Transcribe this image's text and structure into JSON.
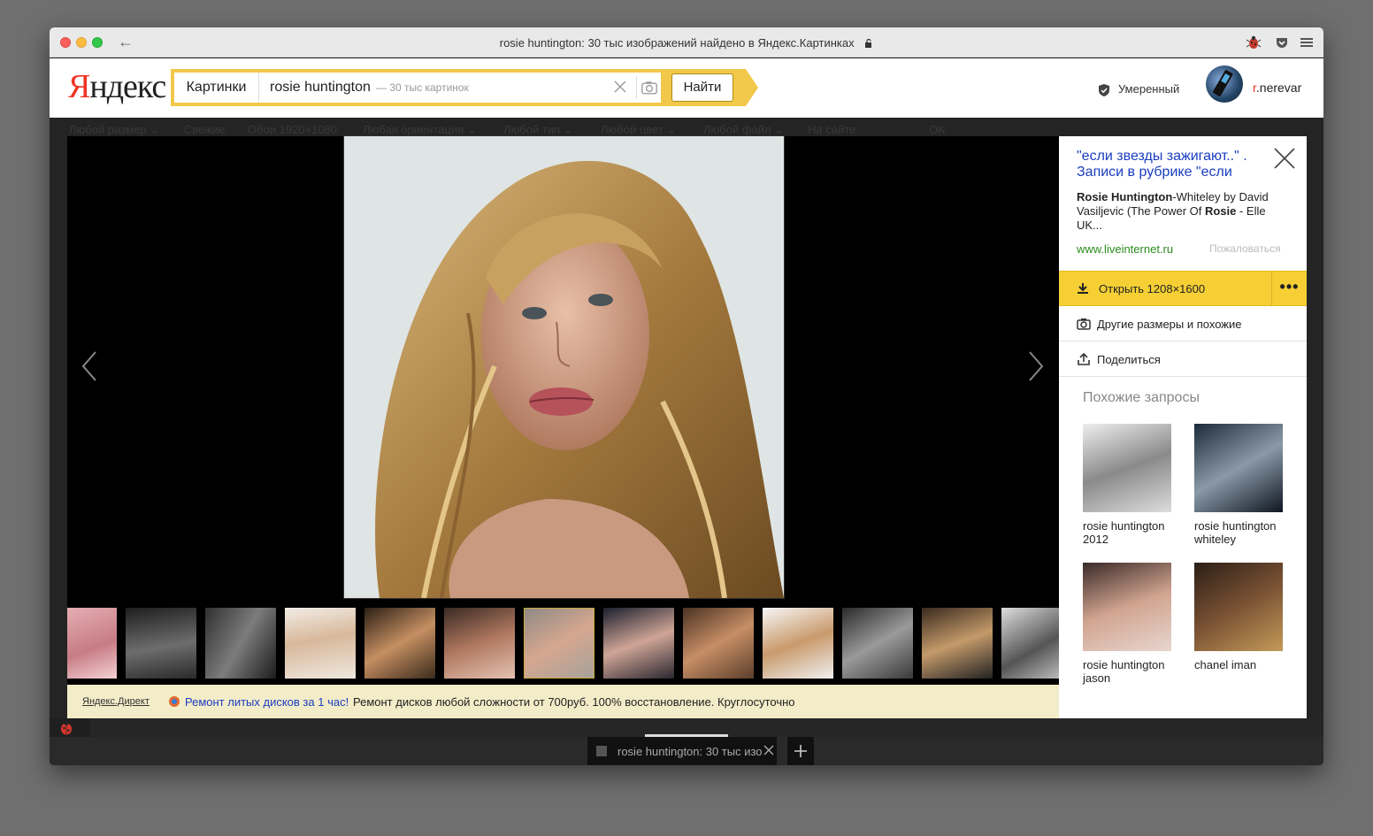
{
  "browser": {
    "title": "rosie huntington: 30 тыс изображений найдено в Яндекс.Картинках",
    "tab_label": "rosie huntington: 30 тыс изображений",
    "icons": [
      "back-arrow-icon",
      "lock-icon",
      "bug-icon",
      "pocket-icon",
      "menu-icon"
    ]
  },
  "header": {
    "logo_first": "Я",
    "logo_rest": "ндекс",
    "search_service": "Картинки",
    "search_query": "rosie huntington",
    "search_hint": "— 30 тыс картинок",
    "search_button": "Найти",
    "safe_search": "Умеренный",
    "user_first": "r",
    "user_rest": ".nerevar",
    "accent": "#f2c84b"
  },
  "filters": [
    "Любой размер ⌄",
    "Свежие",
    "Обои 1920×1080",
    "Любая ориентация ⌄",
    "Любой тип ⌄",
    "Любой цвет ⌄",
    "Любой файл ⌄",
    "На сайте",
    "OK"
  ],
  "panel": {
    "title": "\"если звезды зажигают..\" . Записи в рубрике \"если",
    "desc_bold1": "Rosie Huntington",
    "desc_text1": "-Whiteley by David Vasiljevic (The Power Of ",
    "desc_bold2": "Rosie",
    "desc_text2": " - Elle UK...",
    "site": "www.liveinternet.ru",
    "report": "Пожаловаться",
    "open_label": "Открыть 1208×1600",
    "more": "•••",
    "other_sizes": "Другие размеры и похожие",
    "share": "Поделиться",
    "related_heading": "Похожие запросы",
    "related": [
      {
        "label": "rosie huntington 2012"
      },
      {
        "label": "rosie huntington whiteley"
      },
      {
        "label": "rosie huntington jason"
      },
      {
        "label": "chanel iman"
      }
    ]
  },
  "ad": {
    "source": "Яндекс.Директ",
    "title": "Ремонт литых дисков за 1 час!",
    "text": "Ремонт дисков любой сложности от 700руб. 100% восстановление. Круглосуточно"
  },
  "thumbnails": {
    "count": 13,
    "active_index": 6
  }
}
